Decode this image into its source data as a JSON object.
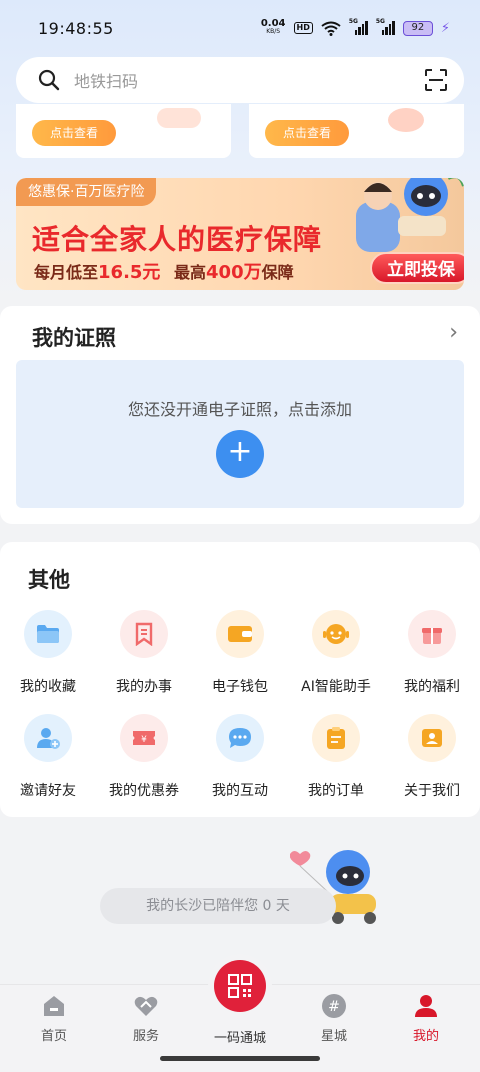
{
  "status_bar": {
    "time": "19:48:55",
    "net_speed_value": "0.04",
    "net_speed_unit": "KB/S",
    "hd_label": "HD",
    "signal1_label": "5G",
    "signal2_label": "5G",
    "battery": "92"
  },
  "search": {
    "placeholder": "地铁扫码"
  },
  "top_cards": [
    {
      "button": "点击查看"
    },
    {
      "button": "点击查看"
    }
  ],
  "banner": {
    "tag": "悠惠保·百万医疗险",
    "title": "适合全家人的医疗保障",
    "sub_prefix": "每月低至",
    "sub_price": "16.5元",
    "sub_mid": "最高",
    "sub_amount": "400万",
    "sub_suffix": "保障",
    "button": "立即投保"
  },
  "license": {
    "title": "我的证照",
    "empty_text": "您还没开通电子证照，点击添加"
  },
  "other": {
    "title": "其他",
    "items": [
      {
        "label": "我的收藏",
        "icon": "folder-icon",
        "bg": "#e3f1fd",
        "fg": "#5aa9f0"
      },
      {
        "label": "我的办事",
        "icon": "bookmark-icon",
        "bg": "#fdebea",
        "fg": "#f06a6a"
      },
      {
        "label": "电子钱包",
        "icon": "wallet-icon",
        "bg": "#fff1dd",
        "fg": "#f5a623"
      },
      {
        "label": "AI智能助手",
        "icon": "robot-icon",
        "bg": "#fff1dd",
        "fg": "#f5a623"
      },
      {
        "label": "我的福利",
        "icon": "gift-icon",
        "bg": "#fdebea",
        "fg": "#f06a6a"
      },
      {
        "label": "邀请好友",
        "icon": "add-user-icon",
        "bg": "#e3f1fd",
        "fg": "#5aa9f0"
      },
      {
        "label": "我的优惠券",
        "icon": "coupon-icon",
        "bg": "#fdebea",
        "fg": "#f06a6a"
      },
      {
        "label": "我的互动",
        "icon": "chat-icon",
        "bg": "#e3f1fd",
        "fg": "#5aa9f0"
      },
      {
        "label": "我的订单",
        "icon": "order-icon",
        "bg": "#fff1dd",
        "fg": "#f5a623"
      },
      {
        "label": "关于我们",
        "icon": "about-icon",
        "bg": "#fff1dd",
        "fg": "#f5a623"
      }
    ]
  },
  "companion_text": "我的长沙已陪伴您 0 天",
  "nav": {
    "home": "首页",
    "service": "服务",
    "center": "一码通城",
    "star": "星城",
    "mine": "我的"
  },
  "colors": {
    "accent": "#d8172a",
    "blue": "#3d8ff0"
  }
}
